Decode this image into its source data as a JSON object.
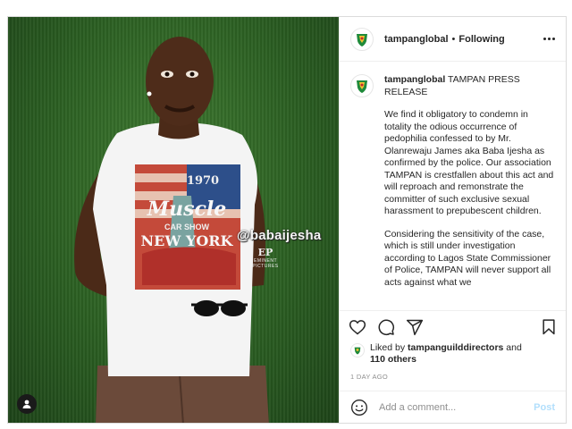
{
  "post": {
    "watermark": "@babaijesha",
    "brand_monogram": "EP",
    "brand_name": "EMINENT PICTURES",
    "shirt": {
      "year": "1970",
      "main": "Muscle",
      "sub": "CAR SHOW",
      "city": "NEW YORK"
    }
  },
  "header": {
    "username": "tampanglobal",
    "separator": "•",
    "follow_status": "Following"
  },
  "caption": {
    "username": "tampanglobal",
    "title": " TAMPAN PRESS RELEASE",
    "paragraph_1": "We find it obligatory to condemn in totality the odious occurrence of pedophilia confessed to by Mr. Olanrewaju James aka Baba Ijesha as confirmed by the police. Our association TAMPAN is crestfallen about this act and will reproach and remonstrate the committer of such exclusive sexual harassment to prepubescent children.",
    "paragraph_2": "Considering the sensitivity of the case, which is still under investigation according to Lagos State Commissioner of Police, TAMPAN will never support all acts against what we"
  },
  "likes": {
    "prefix": "Liked by ",
    "user": "tampanguilddirectors",
    "middle": " and ",
    "others": "110 others"
  },
  "timestamp": "1 DAY AGO",
  "comment": {
    "placeholder": "Add a comment...",
    "post_label": "Post"
  },
  "colors": {
    "text": "#262626",
    "muted": "#8e8e8e",
    "post_disabled": "#b2dffc",
    "border": "#dbdbdb",
    "grass": "#2b5f22"
  },
  "icons": [
    "emblem-icon",
    "more-options-icon",
    "heart-icon",
    "comment-icon",
    "share-icon",
    "bookmark-icon",
    "emoji-icon",
    "user-tag-icon"
  ]
}
